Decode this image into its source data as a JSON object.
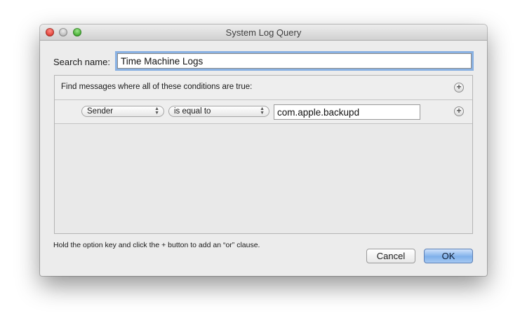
{
  "window": {
    "title": "System Log Query"
  },
  "search": {
    "label": "Search name:",
    "value": "Time Machine Logs"
  },
  "conditions": {
    "header": "Find messages where all of these conditions are true:",
    "rows": [
      {
        "attribute": "Sender",
        "operator": "is equal to",
        "value": "com.apple.backupd"
      }
    ]
  },
  "hint": "Hold the option key and click the + button to add an “or” clause.",
  "buttons": {
    "cancel": "Cancel",
    "ok": "OK"
  },
  "icons": {
    "add": "plus-icon",
    "popup": "up-down-arrows-icon"
  },
  "colors": {
    "focus_ring": "#89b1e2",
    "default_button": "#7fb0ea",
    "close": "#de3a30",
    "minimize": "#b7b7b7",
    "zoom": "#3eaa2b"
  }
}
